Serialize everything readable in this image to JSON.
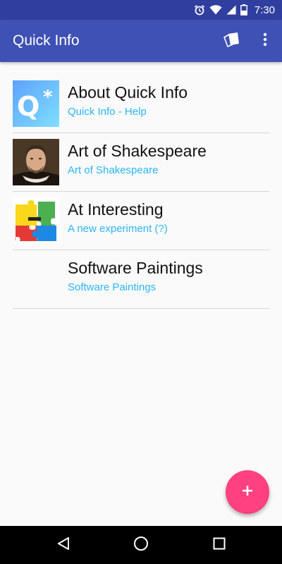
{
  "status_bar": {
    "time": "7:30",
    "icons": [
      "alarm-icon",
      "wifi-icon",
      "signal-icon",
      "battery-icon"
    ]
  },
  "app_bar": {
    "title": "Quick Info",
    "actions": [
      "cards-icon",
      "more-vert-icon"
    ]
  },
  "list": {
    "items": [
      {
        "title": "About Quick Info",
        "subtitle": "Quick Info - Help",
        "thumbnail": "quick-info-logo"
      },
      {
        "title": "Art of Shakespeare",
        "subtitle": "Art of Shakespeare",
        "thumbnail": "shakespeare-portrait"
      },
      {
        "title": "At Interesting",
        "subtitle": "A new experiment (?)",
        "thumbnail": "puzzle-pieces"
      },
      {
        "title": "Software Paintings",
        "subtitle": "Software Paintings",
        "thumbnail": ""
      }
    ]
  },
  "fab": {
    "icon": "add-icon"
  },
  "nav_bar": {
    "buttons": [
      "back-icon",
      "home-icon",
      "recents-icon"
    ]
  },
  "colors": {
    "status_bar": "#303f9f",
    "app_bar": "#3f51b5",
    "subtitle": "#29b6f6",
    "fab": "#ff4081",
    "divider": "#d6d6d6"
  }
}
